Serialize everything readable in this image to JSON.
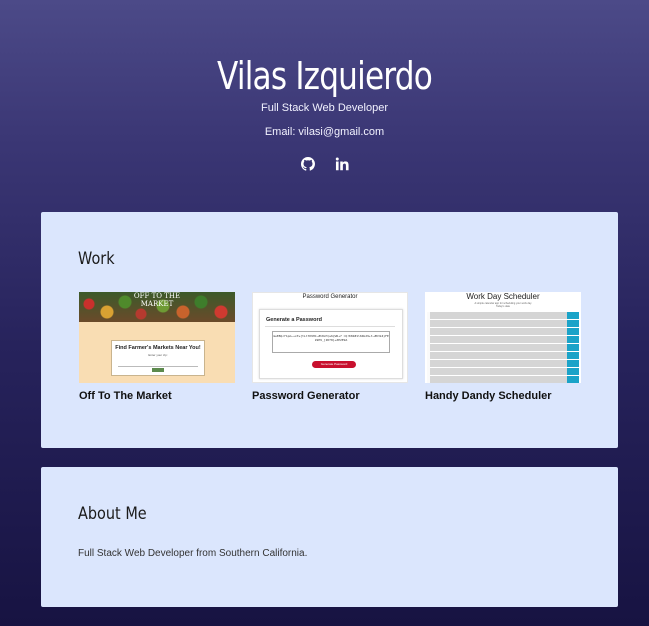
{
  "header": {
    "name": "Vilas Izquierdo",
    "subtitle": "Full Stack Web Developer",
    "email": "Email: vilasi@gmail.com",
    "socials": [
      {
        "icon": "github-icon"
      },
      {
        "icon": "linkedin-icon"
      }
    ]
  },
  "work": {
    "title": "Work",
    "projects": [
      {
        "title": "Off To The Market",
        "thumbnail": {
          "banner": "OFF TO THE MARKET",
          "heading": "Find Farmer's Markets Near You!",
          "subheading": "Enter your zip:"
        }
      },
      {
        "title": "Password Generator",
        "thumbnail": {
          "heading": "Password Generator",
          "panel_title": "Generate a Password",
          "password": "mwE8Q<f1pm~+x3v{tLl7K9HC~#h8xH(w6{W6+7 =Q!K8Z#1l6Nxd9+t~#K3k4}FE k9P9_[ZOf8}+ZE2E9A",
          "button": "Generate Password"
        }
      },
      {
        "title": "Handy Dandy Scheduler",
        "thumbnail": {
          "heading": "Work Day Scheduler",
          "subheading": "A simple calendar app for scheduling your work day",
          "date": "Today's date"
        }
      }
    ]
  },
  "about": {
    "title": "About Me",
    "text": "Full Stack Web Developer from Southern California."
  },
  "colors": {
    "background_top": "#4c4a88",
    "background_bottom": "#171342",
    "card": "#dbe6fd",
    "password_button": "#c8102e",
    "scheduler_save": "#1aa3c8"
  }
}
